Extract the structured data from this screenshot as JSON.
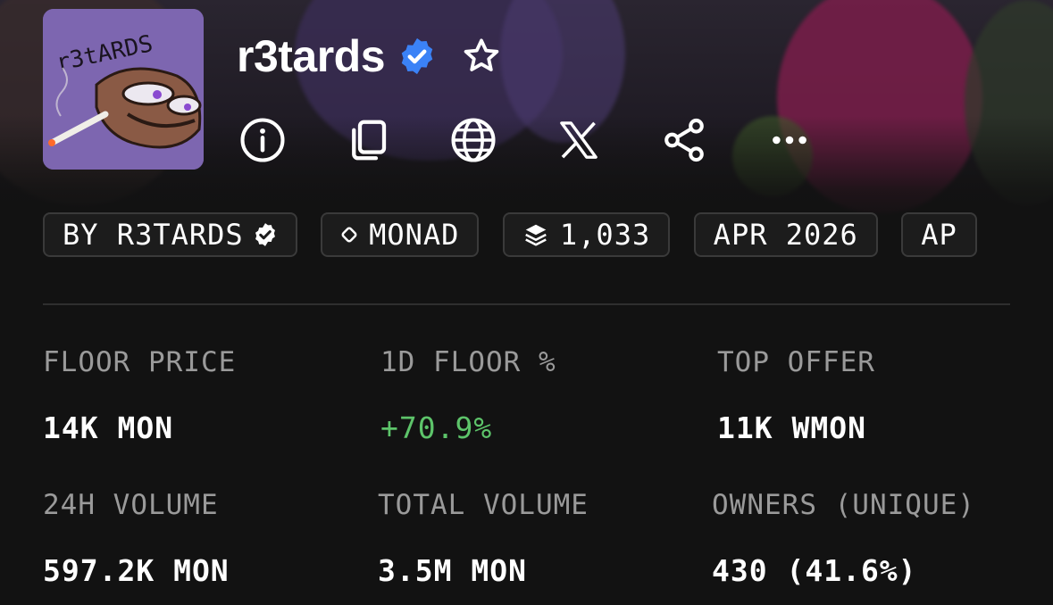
{
  "collection": {
    "name": "r3tards",
    "verified": true,
    "avatar_text": "r3tARDS"
  },
  "actions": [
    {
      "name": "info-icon"
    },
    {
      "name": "copy-icon"
    },
    {
      "name": "globe-icon"
    },
    {
      "name": "x-logo-icon"
    },
    {
      "name": "share-icon"
    },
    {
      "name": "more-icon"
    }
  ],
  "chips": {
    "creator": "BY R3TARDS",
    "chain": "MONAD",
    "items": "1,033",
    "date": "APR 2026",
    "extra": "AP"
  },
  "stats": {
    "floor_price": {
      "label": "FLOOR PRICE",
      "value": "14K MON"
    },
    "floor_change": {
      "label": "1D FLOOR %",
      "value": "+70.9%"
    },
    "top_offer": {
      "label": "TOP OFFER",
      "value": "11K WMON"
    },
    "volume_24h": {
      "label": "24H VOLUME",
      "value": "597.2K MON"
    },
    "total_volume": {
      "label": "TOTAL VOLUME",
      "value": "3.5M MON"
    },
    "owners": {
      "label": "OWNERS (UNIQUE)",
      "value": "430 (41.6%)"
    }
  },
  "colors": {
    "background": "#121212",
    "positive": "#5dc46a",
    "verified": "#3b82f6",
    "label": "#9a9a9a"
  }
}
